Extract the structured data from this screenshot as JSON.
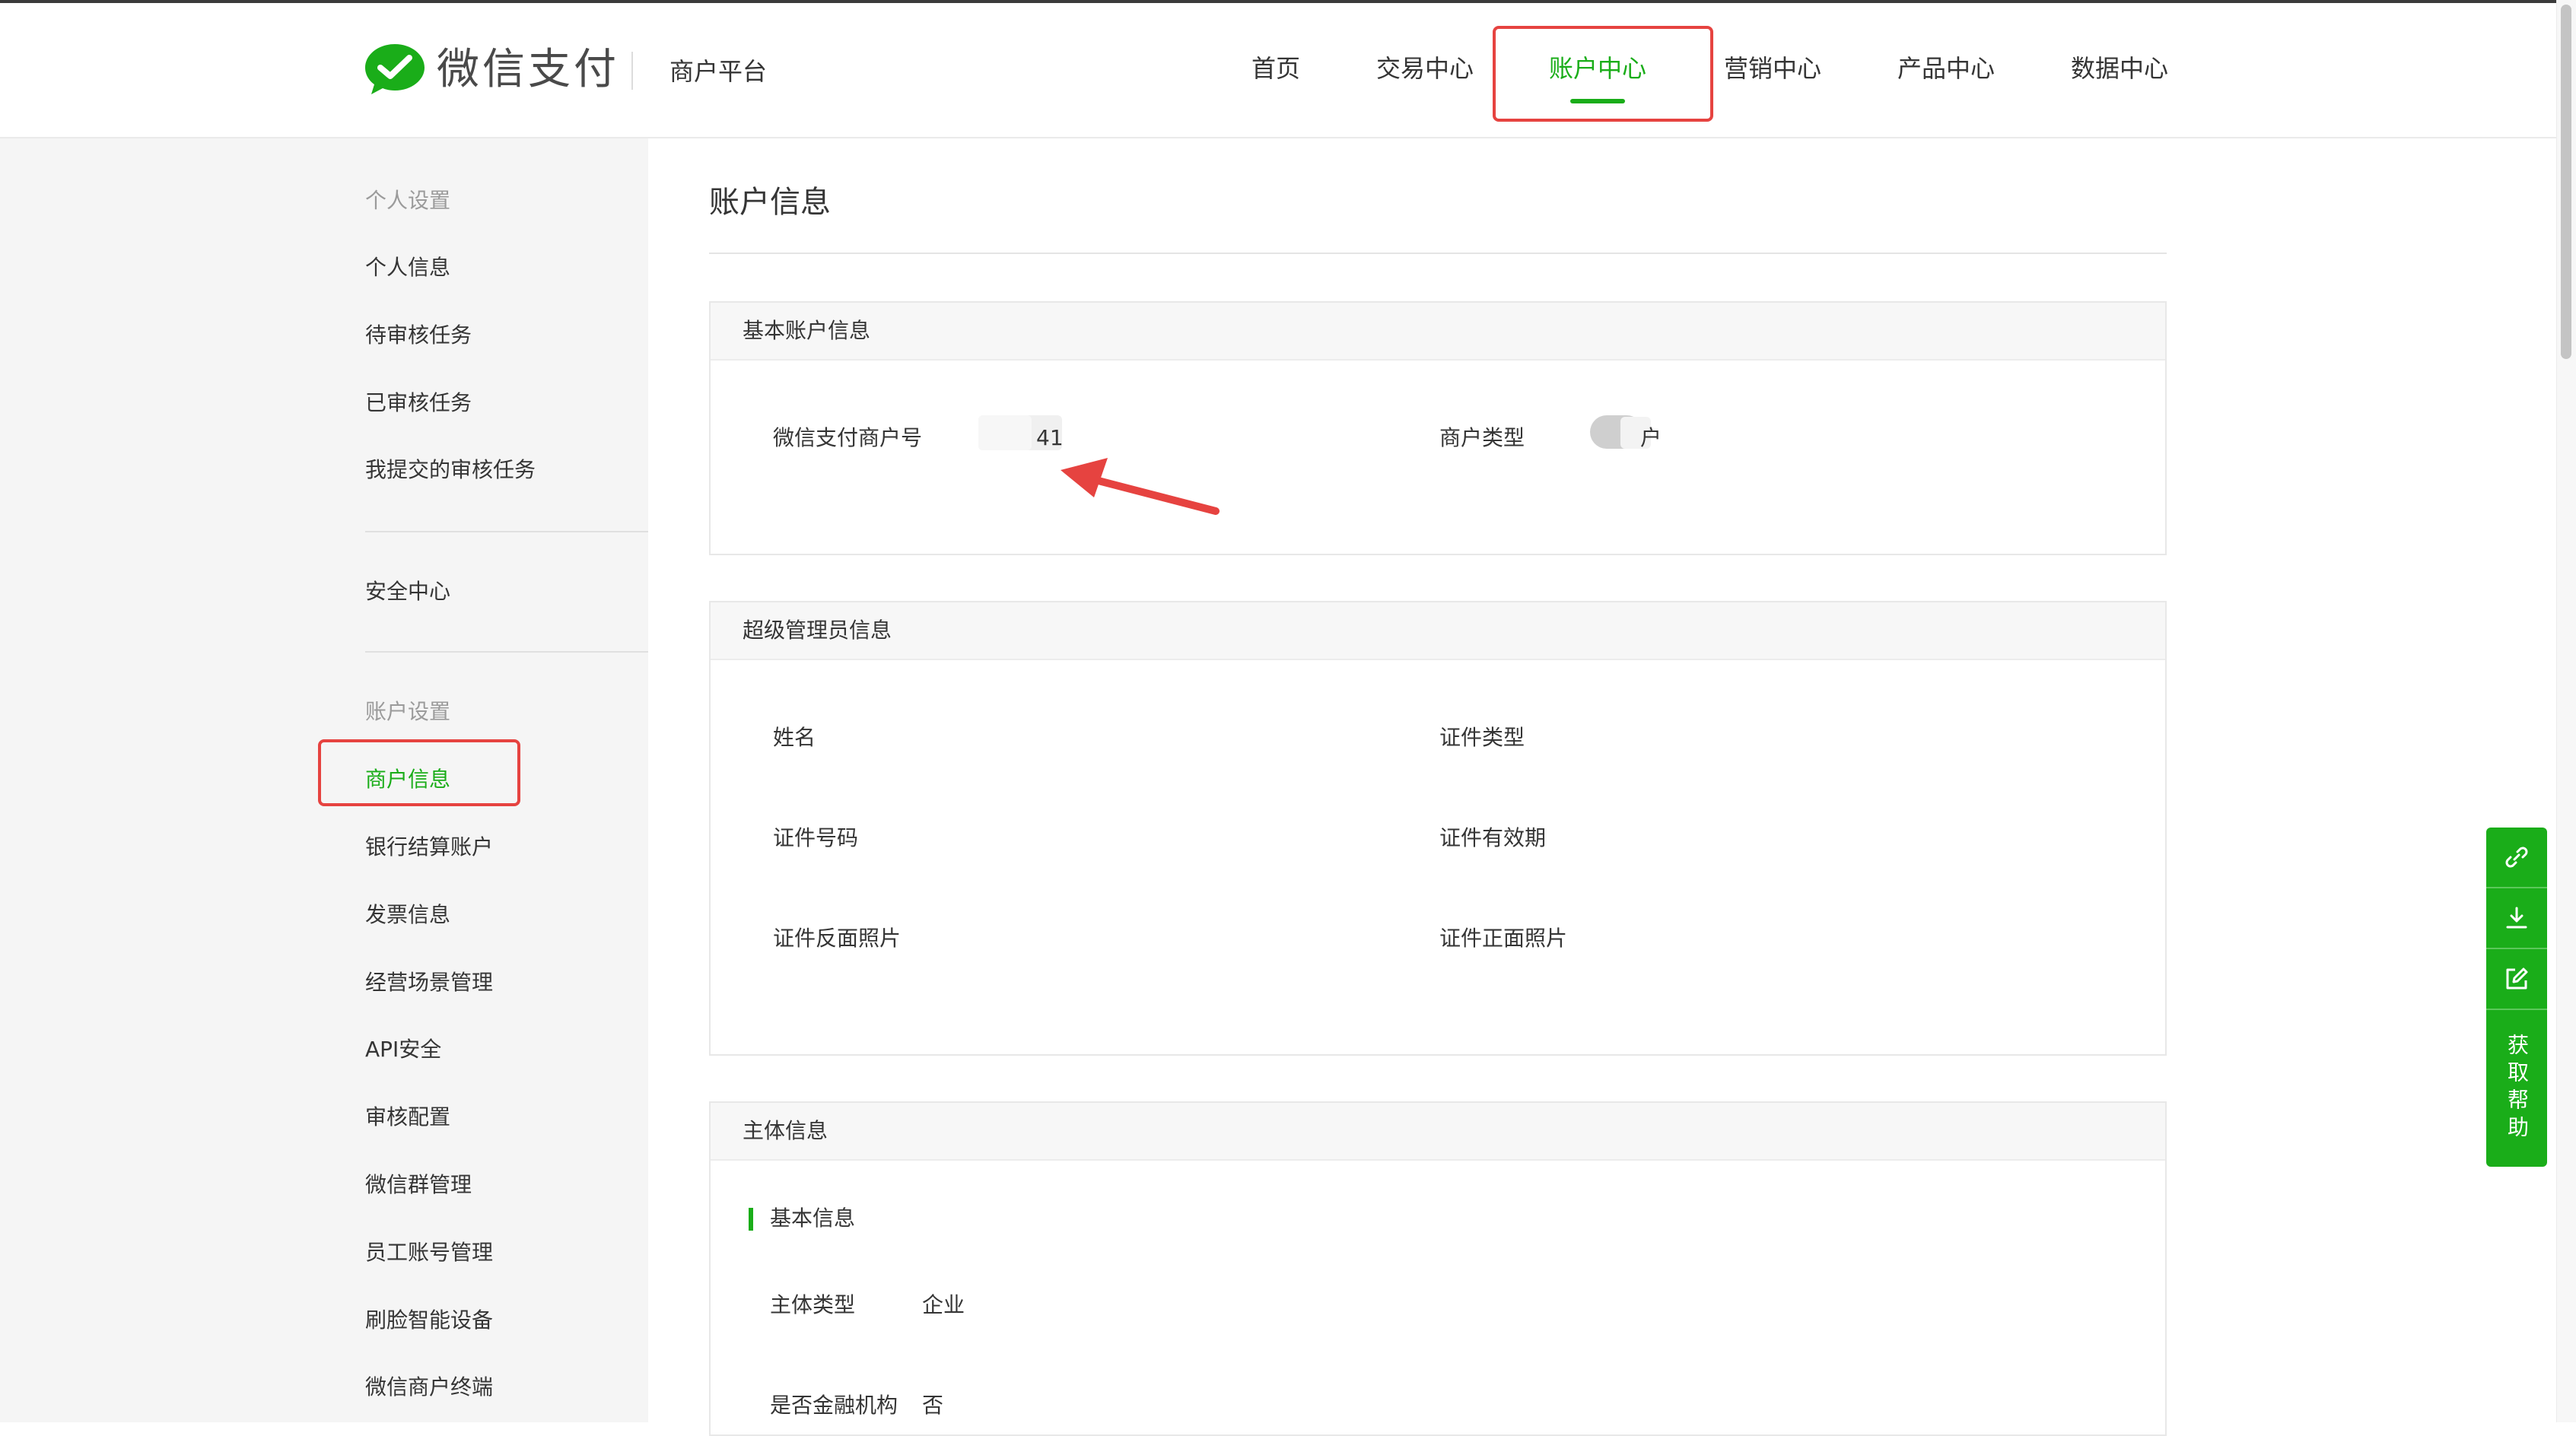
{
  "header": {
    "logo_text": "微信支付",
    "platform": "商户平台",
    "nav": [
      {
        "label": "首页"
      },
      {
        "label": "交易中心"
      },
      {
        "label": "账户中心"
      },
      {
        "label": "营销中心"
      },
      {
        "label": "产品中心"
      },
      {
        "label": "数据中心"
      }
    ],
    "active_nav": "账户中心"
  },
  "sidebar": {
    "group1": "个人设置",
    "group1_items": [
      "个人信息",
      "待审核任务",
      "已审核任务",
      "我提交的审核任务"
    ],
    "security": "安全中心",
    "group2": "账户设置",
    "group2_items": [
      "商户信息",
      "银行结算账户",
      "发票信息",
      "经营场景管理",
      "API安全",
      "审核配置",
      "微信群管理",
      "员工账号管理",
      "刷脸智能设备",
      "微信商户终端"
    ],
    "active_item": "商户信息"
  },
  "main": {
    "page_title": "账户信息",
    "basic": {
      "title": "基本账户信息",
      "merchant_id_label": "微信支付商户号",
      "merchant_id_value": "41",
      "merchant_type_label": "商户类型",
      "merchant_type_value": "户"
    },
    "admin": {
      "title": "超级管理员信息",
      "name_label": "姓名",
      "id_type_label": "证件类型",
      "id_number_label": "证件号码",
      "id_validity_label": "证件有效期",
      "id_back_label": "证件反面照片",
      "id_front_label": "证件正面照片"
    },
    "subject": {
      "title": "主体信息",
      "subsection": "基本信息",
      "type_label": "主体类型",
      "type_value": "企业",
      "financial_label": "是否金融机构",
      "financial_value": "否"
    }
  },
  "float_toolbar": {
    "icons": [
      "link-icon",
      "download-icon",
      "edit-icon"
    ],
    "help_label": "获取帮助"
  },
  "colors": {
    "brand_green": "#1aad19",
    "highlight_red": "#e64340"
  }
}
